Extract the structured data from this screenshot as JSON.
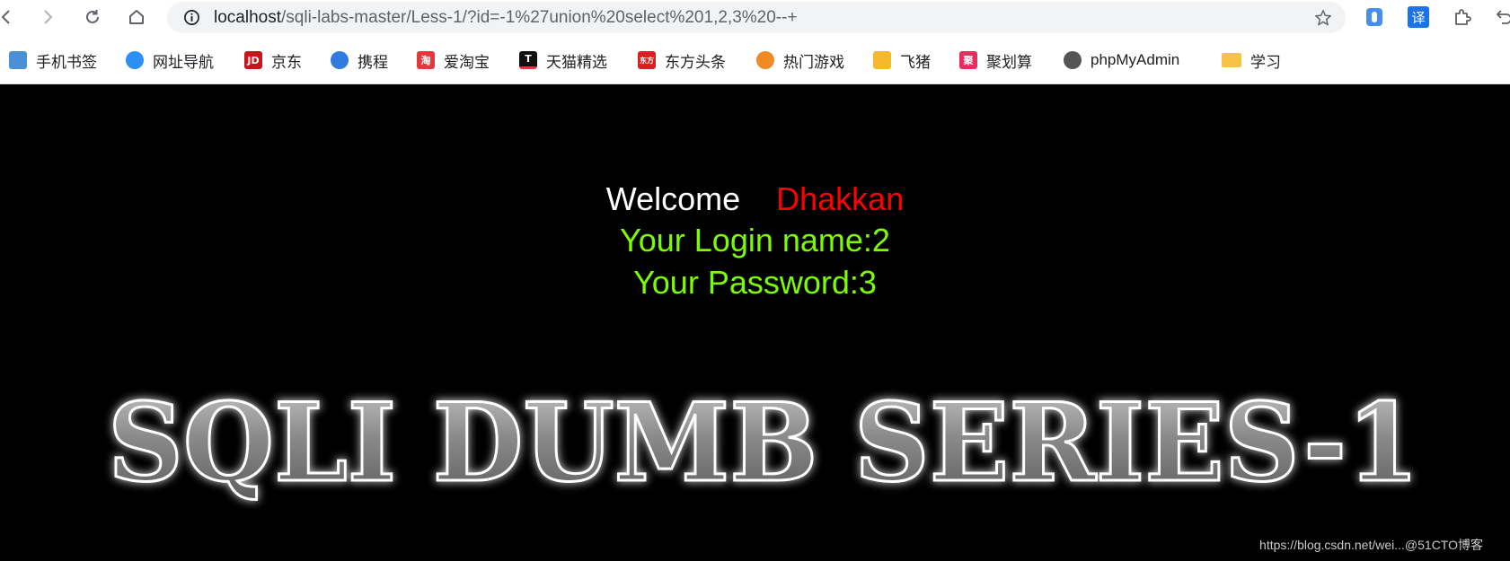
{
  "browser": {
    "url_host": "localhost",
    "url_path": "/sqli-labs-master/Less-1/?id=-1%27union%20select%201,2,3%20--+",
    "translate_icon_text": "译",
    "bookmarks": [
      {
        "label": "手机书签",
        "icon": "mobile-icon",
        "color": "#4a90d9"
      },
      {
        "label": "网址导航",
        "icon": "nav-icon",
        "color": "#2b8ff5"
      },
      {
        "label": "京东",
        "icon": "jd-icon",
        "color": "#c7151b",
        "glyph": "JD"
      },
      {
        "label": "携程",
        "icon": "ctrip-icon",
        "color": "#2f7be0"
      },
      {
        "label": "爱淘宝",
        "icon": "taobao-icon",
        "color": "#e4393c",
        "glyph": "淘"
      },
      {
        "label": "天猫精选",
        "icon": "tmall-icon",
        "color": "#111111",
        "glyph": "T"
      },
      {
        "label": "东方头条",
        "icon": "toutiao-icon",
        "color": "#d91f1f",
        "glyph": "东方"
      },
      {
        "label": "热门游戏",
        "icon": "games-icon",
        "color": "#f08a24"
      },
      {
        "label": "飞猪",
        "icon": "fliggy-icon",
        "color": "#f5b82e"
      },
      {
        "label": "聚划算",
        "icon": "juhuasuan-icon",
        "color": "#e82c5f",
        "glyph": "聚"
      },
      {
        "label": "phpMyAdmin",
        "icon": "phpmyadmin-icon",
        "color": "#555555"
      },
      {
        "label": "学习",
        "icon": "folder-icon",
        "color": "#f6c344"
      }
    ]
  },
  "page": {
    "welcome": "Welcome",
    "username": "Dhakkan",
    "login_name": "Your Login name:2",
    "password": "Your Password:3",
    "banner_text": "SQLI DUMB SERIES-1",
    "watermark": "https://blog.csdn.net/wei...@51CTO博客"
  },
  "colors": {
    "welcome": "#ffffff",
    "username": "#ff0000",
    "info": "#7cfc00",
    "background": "#000000"
  }
}
